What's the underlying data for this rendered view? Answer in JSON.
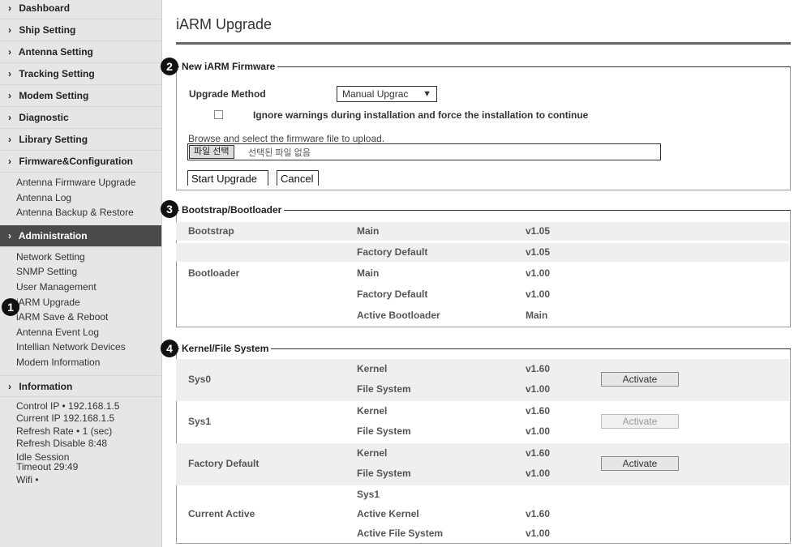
{
  "sidebar": {
    "nav": [
      {
        "label": "Dashboard"
      },
      {
        "label": "Ship Setting"
      },
      {
        "label": "Antenna Setting"
      },
      {
        "label": "Tracking Setting"
      },
      {
        "label": "Modem Setting"
      },
      {
        "label": "Diagnostic"
      },
      {
        "label": "Library Setting"
      },
      {
        "label": "Firmware&Configuration"
      }
    ],
    "firmware_sub": [
      "Antenna Firmware Upgrade",
      "Antenna Log",
      "Antenna Backup & Restore"
    ],
    "administration": "Administration",
    "admin_sub": [
      "Network Setting",
      "SNMP Setting",
      "User Management",
      "iARM Upgrade",
      "iARM Save & Reboot",
      "Antenna Event Log",
      "Intellian Network Devices",
      "Modem Information"
    ],
    "information": "Information",
    "info_lines": [
      "Control IP • 192.168.1.5",
      "Current IP   192.168.1.5",
      "Refresh Rate •     1 (sec)",
      "Refresh Disable   8:48",
      "Idle Session",
      "Timeout  29:49",
      "Wifi  •"
    ]
  },
  "callouts": [
    "1",
    "2",
    "3",
    "4"
  ],
  "page": {
    "title": "iARM Upgrade"
  },
  "firmware": {
    "legend": "New iARM Firmware",
    "upgrade_method_label": "Upgrade Method",
    "upgrade_method_value": "Manual Upgrac",
    "ignore_warnings_label": "Ignore warnings during installation and force the installation to continue",
    "browse_label": "Browse and select the firmware file to upload.",
    "file_button": "파일 선택",
    "file_status": "선택된 파일 없음",
    "start_button": "Start Upgrade",
    "cancel_button": "Cancel"
  },
  "bootstrap": {
    "legend": "Bootstrap/Bootloader",
    "rows": [
      [
        "Bootstrap",
        "Main",
        "v1.05"
      ],
      [
        "",
        "Factory Default",
        "v1.05"
      ],
      [
        "Bootloader",
        "Main",
        "v1.00"
      ],
      [
        "",
        "Factory Default",
        "v1.00"
      ],
      [
        "",
        "Active Bootloader",
        "Main"
      ]
    ]
  },
  "kernel": {
    "legend": "Kernel/File System",
    "groups": [
      {
        "name": "Sys0",
        "rows": [
          [
            "Kernel",
            "v1.60"
          ],
          [
            "File System",
            "v1.00"
          ]
        ],
        "button": "Activate"
      },
      {
        "name": "Sys1",
        "rows": [
          [
            "Kernel",
            "v1.60"
          ],
          [
            "File System",
            "v1.00"
          ]
        ],
        "button": "Activate"
      },
      {
        "name": "Factory Default",
        "rows": [
          [
            "Kernel",
            "v1.60"
          ],
          [
            "File System",
            "v1.00"
          ]
        ],
        "button": "Activate"
      }
    ],
    "current": {
      "name": "Current Active",
      "rows": [
        [
          "Sys1",
          ""
        ],
        [
          "Active Kernel",
          "v1.60"
        ],
        [
          "Active File System",
          "v1.00"
        ]
      ]
    }
  }
}
